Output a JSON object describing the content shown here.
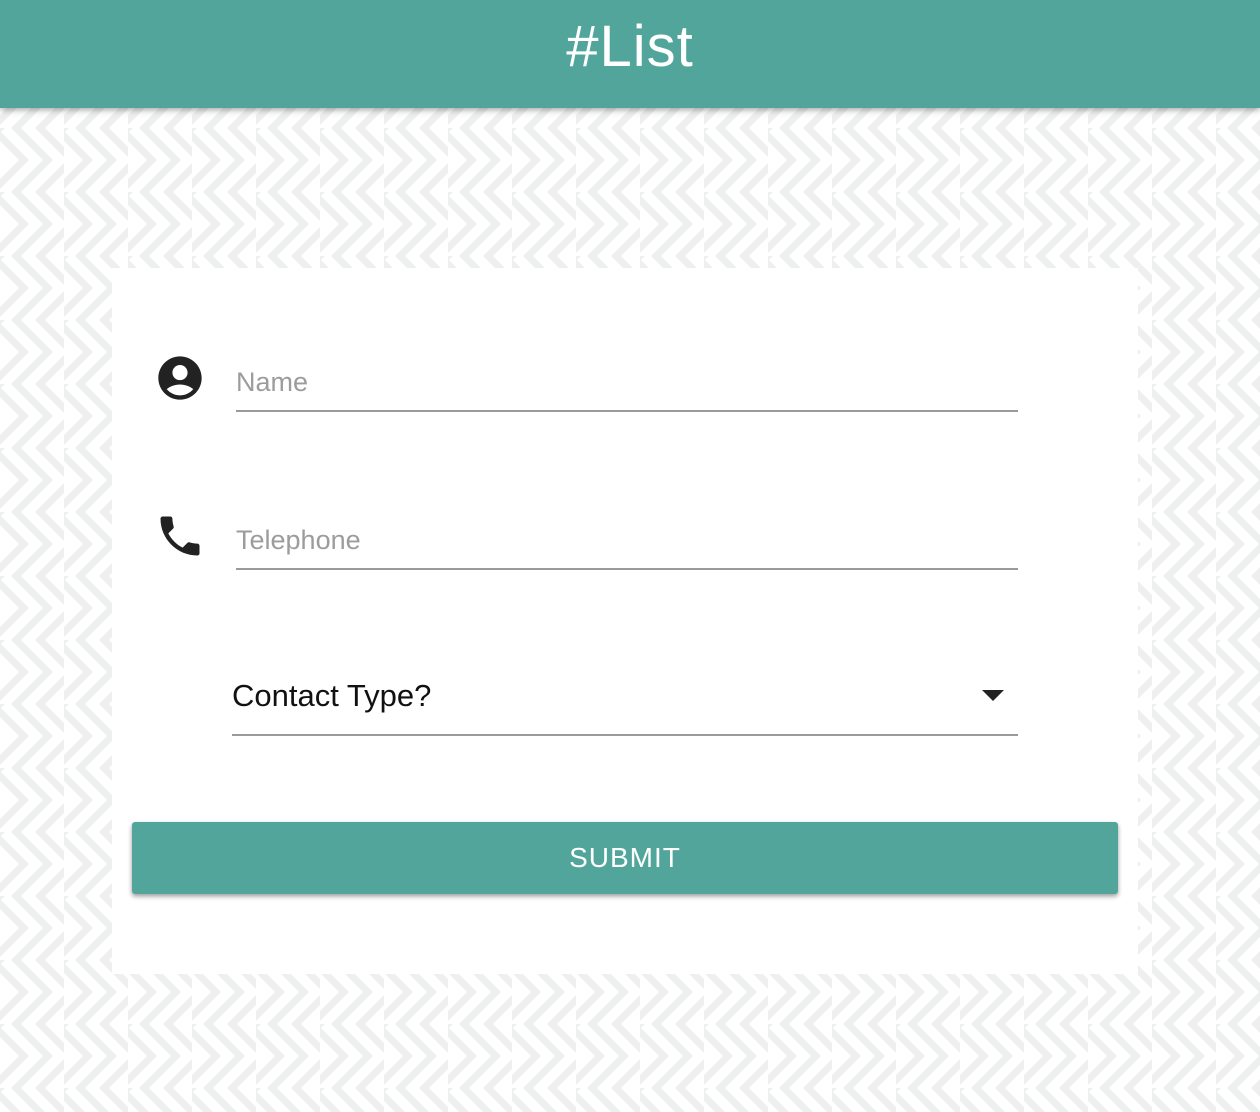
{
  "app": {
    "title": "#List",
    "accent_color": "#52a59b"
  },
  "form": {
    "name": {
      "icon": "account-circle-icon",
      "placeholder": "Name",
      "value": ""
    },
    "telephone": {
      "icon": "phone-icon",
      "placeholder": "Telephone",
      "value": ""
    },
    "contact_type": {
      "selected_label": "Contact Type?",
      "icon": "chevron-down-icon"
    },
    "submit_label": "SUBMIT"
  }
}
